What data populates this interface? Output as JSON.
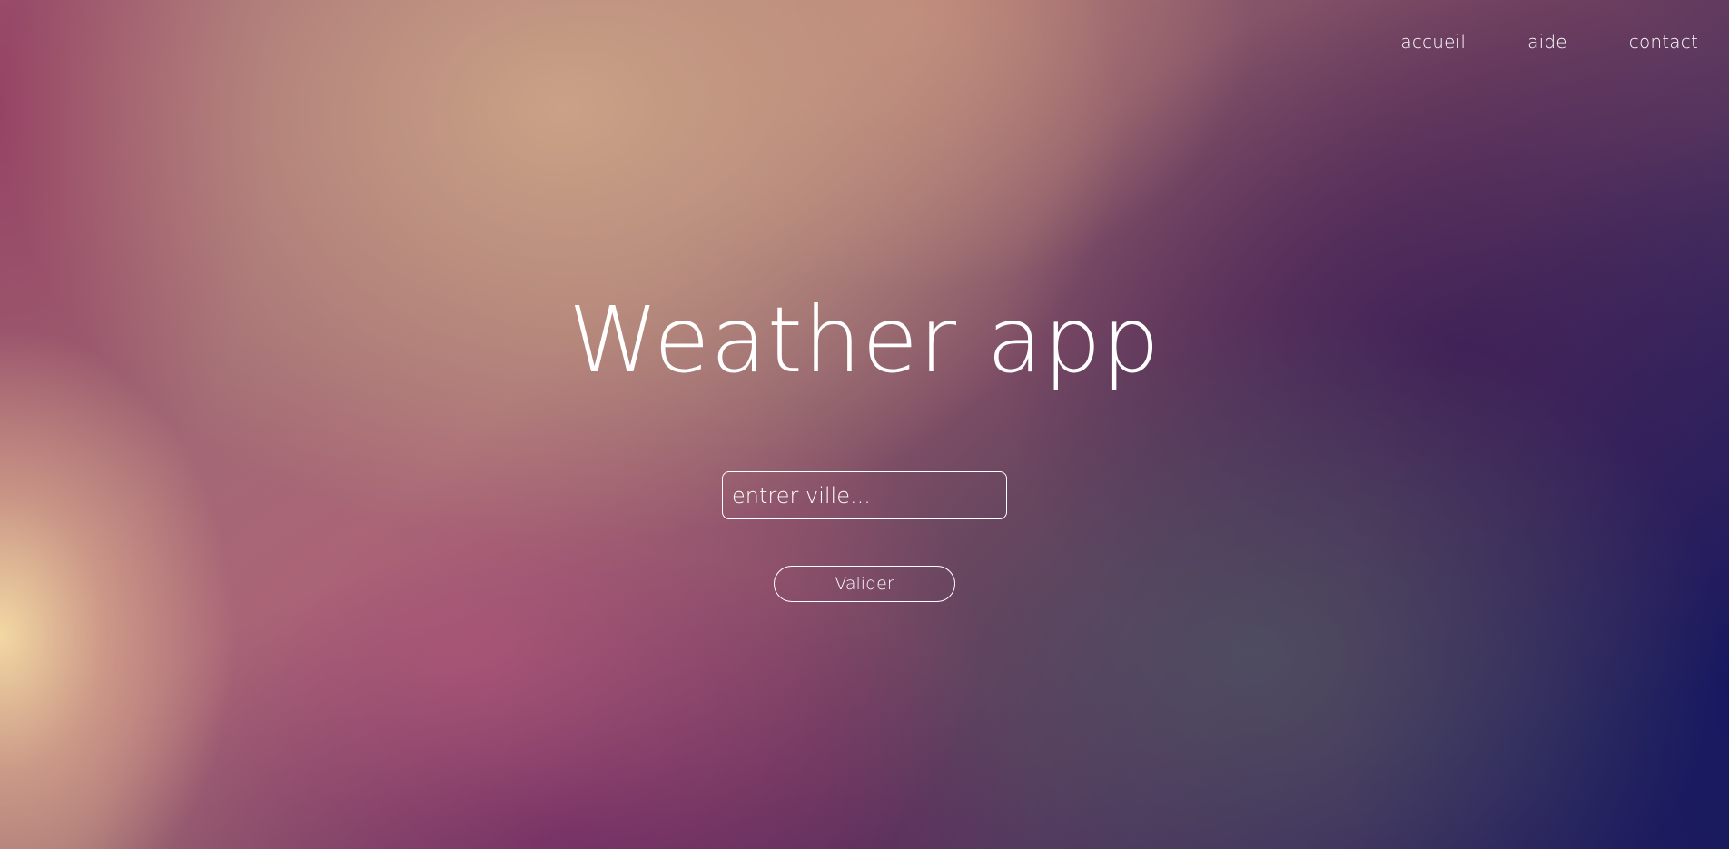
{
  "nav": {
    "items": [
      {
        "label": "accueil"
      },
      {
        "label": "aide"
      },
      {
        "label": "contact"
      }
    ]
  },
  "hero": {
    "title": "Weather app",
    "search": {
      "placeholder": "entrer ville...",
      "value": ""
    },
    "submit_label": "Valider"
  },
  "colors": {
    "text": "#ffffff",
    "gradient_warm": "#f7dea6",
    "gradient_peach": "#cda587",
    "gradient_magenta": "#b4587a",
    "gradient_purple": "#3c1e56",
    "gradient_navy": "#16185f"
  }
}
